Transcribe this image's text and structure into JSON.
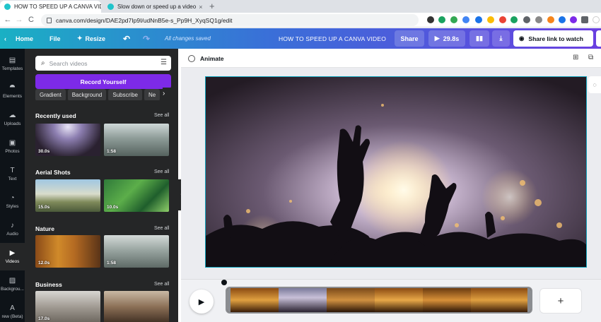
{
  "browser": {
    "tabs": [
      {
        "title": "HOW TO SPEED UP A CANVA VIDE",
        "close": "×"
      },
      {
        "title": "Slow down or speed up a video",
        "close": "×"
      }
    ],
    "new_tab": "+",
    "url": "canva.com/design/DAE2pd7Ip9I/udNnB5e-s_Pp9H_XyqSQ1g/edit",
    "nav": {
      "back": "←",
      "forward": "→",
      "reload": "C"
    }
  },
  "topbar": {
    "home": "Home",
    "file": "File",
    "resize": "Resize",
    "saved_status": "All changes saved",
    "design_title": "HOW TO SPEED UP A CANVA VIDEO",
    "share": "Share",
    "duration": "29.8s",
    "share_link": "Share link to watch"
  },
  "rail": [
    {
      "icon": "▤",
      "label": "Templates"
    },
    {
      "icon": "⯊",
      "label": "Elements"
    },
    {
      "icon": "☁",
      "label": "Uploads"
    },
    {
      "icon": "▣",
      "label": "Photos"
    },
    {
      "icon": "T",
      "label": "Text"
    },
    {
      "icon": "◔",
      "label": "Styles"
    },
    {
      "icon": "♪",
      "label": "Audio"
    },
    {
      "icon": "▶",
      "label": "Videos"
    },
    {
      "icon": "▨",
      "label": "Backgrou..."
    },
    {
      "icon": "A",
      "label": "rew (Beta)"
    }
  ],
  "panel": {
    "search_placeholder": "Search videos",
    "record_button": "Record Yourself",
    "chips": [
      "Gradient",
      "Background",
      "Subscribe",
      "Ne"
    ],
    "see_all": "See all",
    "sections": [
      {
        "title": "Recently used",
        "durations": [
          "30.0s",
          "1:58"
        ]
      },
      {
        "title": "Aerial Shots",
        "durations": [
          "15.0s",
          "10.0s"
        ]
      },
      {
        "title": "Nature",
        "durations": [
          "12.0s",
          "1:58"
        ]
      },
      {
        "title": "Business",
        "durations": [
          "17.0s",
          ""
        ]
      }
    ]
  },
  "editor": {
    "animate": "Animate"
  },
  "timeline": {
    "add": "+"
  },
  "colors": {
    "accent_purple": "#7d2ae8",
    "selection_cyan": "#12a7c0",
    "panel_dark": "#252627",
    "rail_dark": "#0e1318"
  }
}
